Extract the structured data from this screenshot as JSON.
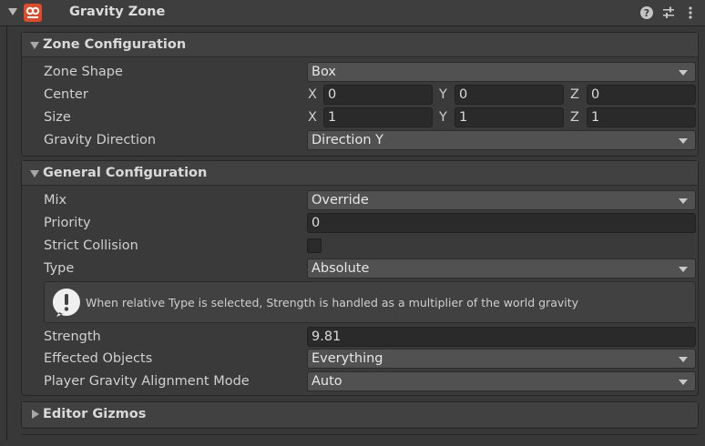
{
  "component": {
    "title": "Gravity Zone",
    "logo_icon": "gravity-logo-icon",
    "header_icons": [
      "help-icon",
      "preset-sliders-icon",
      "kebab-menu-icon"
    ]
  },
  "sections": {
    "zone": {
      "title": "Zone Configuration",
      "zone_shape": {
        "label": "Zone Shape",
        "value": "Box"
      },
      "center": {
        "label": "Center",
        "x_lbl": "X",
        "y_lbl": "Y",
        "z_lbl": "Z",
        "x": "0",
        "y": "0",
        "z": "0"
      },
      "size": {
        "label": "Size",
        "x_lbl": "X",
        "y_lbl": "Y",
        "z_lbl": "Z",
        "x": "1",
        "y": "1",
        "z": "1"
      },
      "gravity_direction": {
        "label": "Gravity Direction",
        "value": "Direction Y"
      }
    },
    "general": {
      "title": "General Configuration",
      "mix": {
        "label": "Mix",
        "value": "Override"
      },
      "priority": {
        "label": "Priority",
        "value": "0"
      },
      "strict_collision": {
        "label": "Strict Collision",
        "checked": false
      },
      "type": {
        "label": "Type",
        "value": "Absolute"
      },
      "help": "When relative Type is selected, Strength is handled as a multiplier of the world gravity",
      "strength": {
        "label": "Strength",
        "value": "9.81"
      },
      "effected_objects": {
        "label": "Effected Objects",
        "value": "Everything"
      },
      "alignment_mode": {
        "label": "Player Gravity Alignment Mode",
        "value": "Auto"
      }
    },
    "gizmos": {
      "title": "Editor Gizmos"
    }
  },
  "colors": {
    "background": "#383838",
    "logo": "#e04a2b"
  }
}
